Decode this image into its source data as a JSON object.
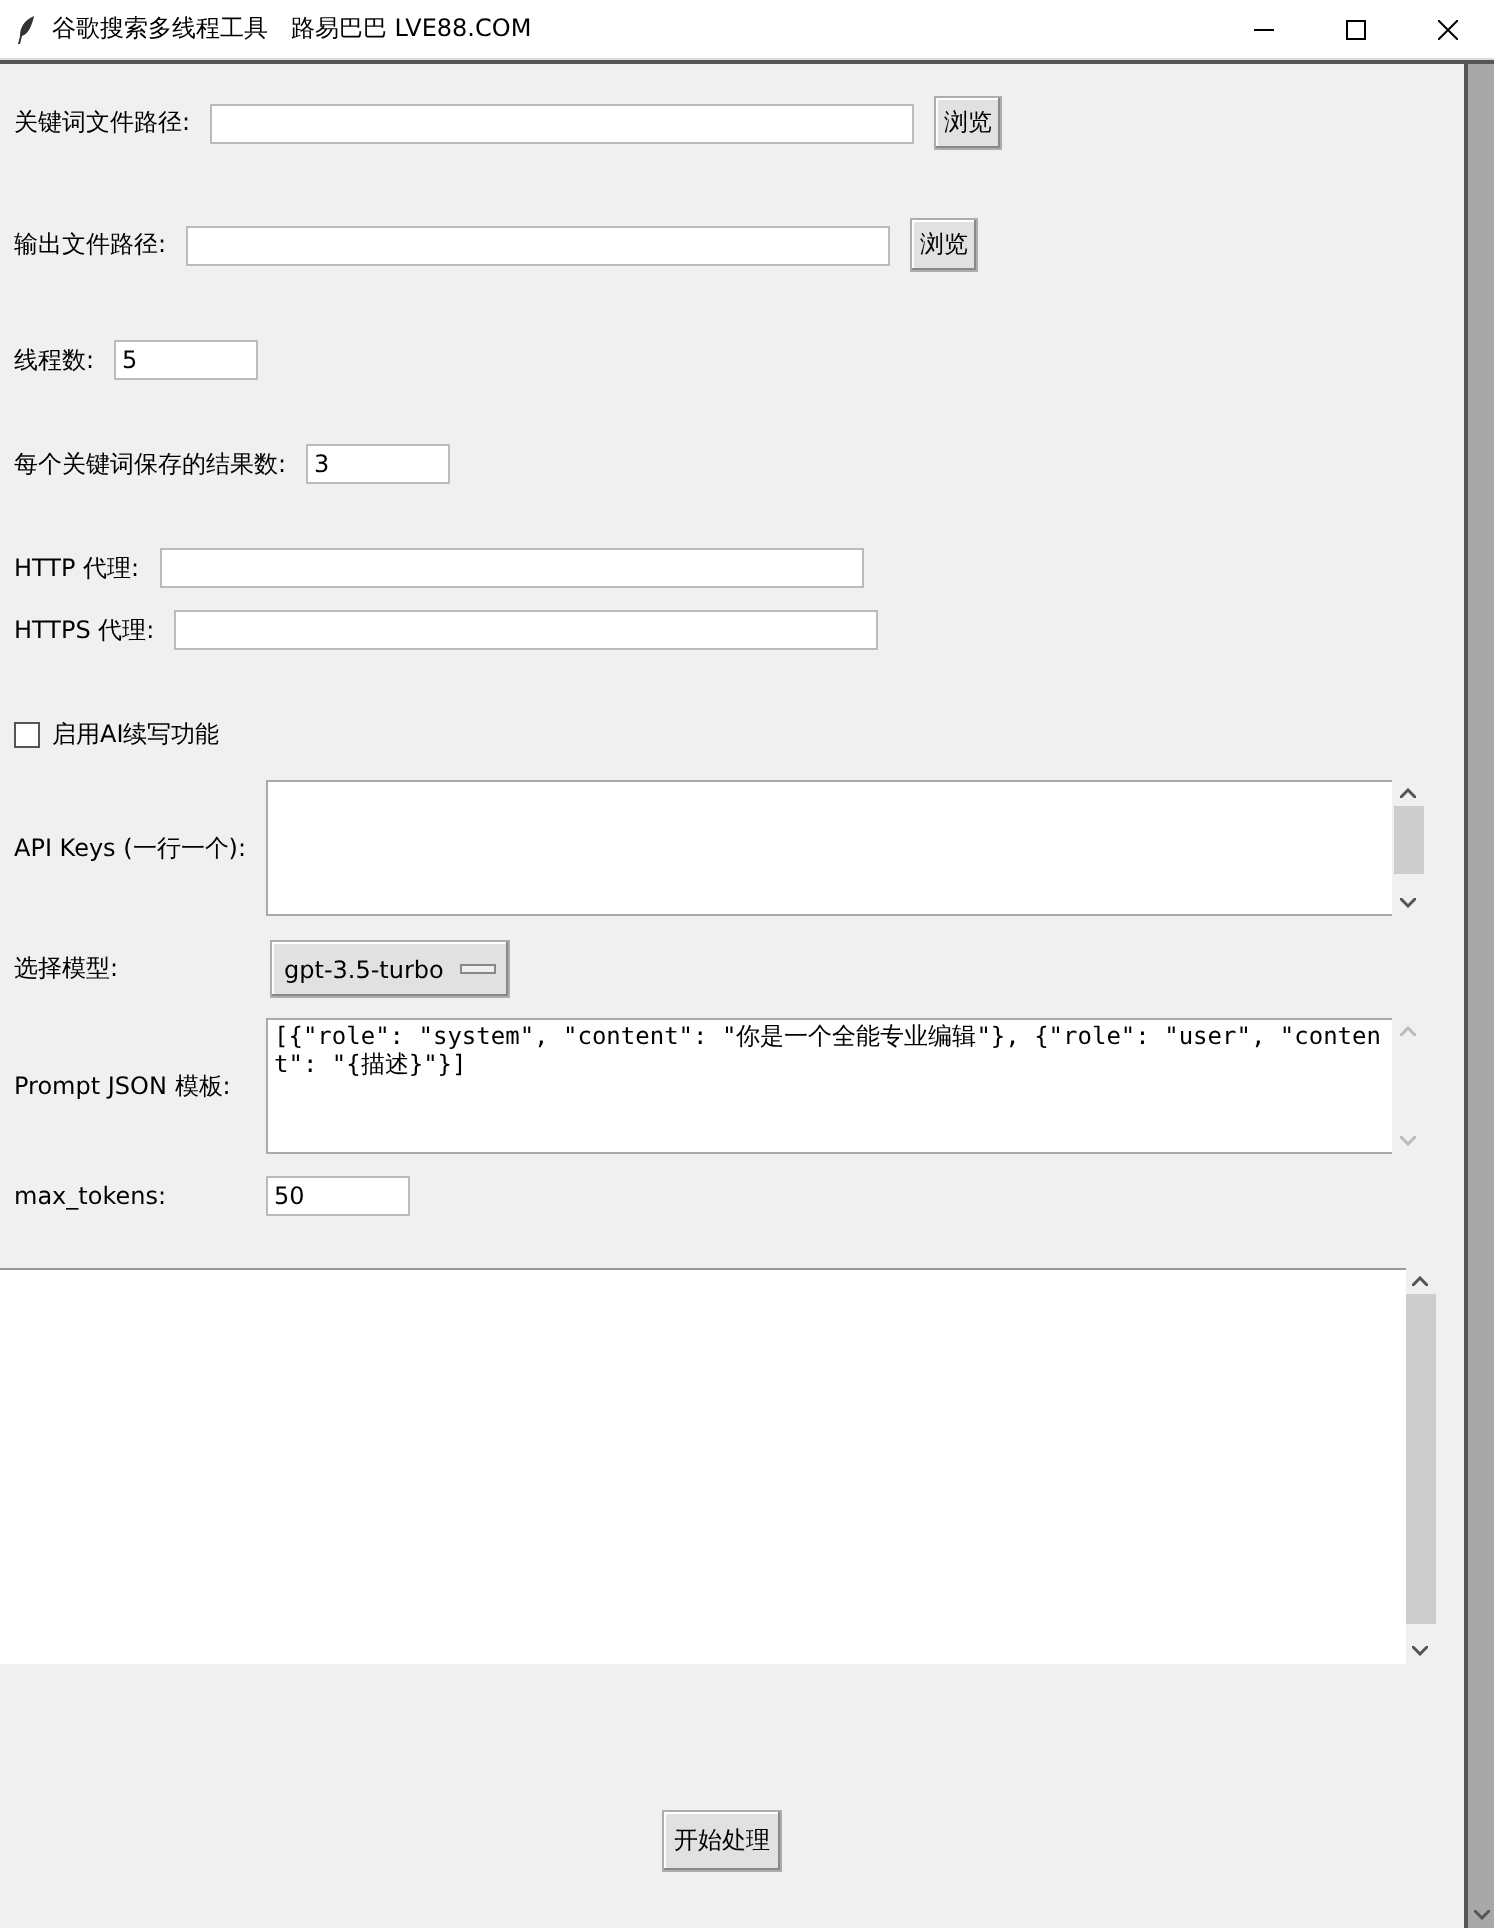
{
  "window": {
    "title": "谷歌搜索多线程工具   路易巴巴 LVE88.COM"
  },
  "keyword_file": {
    "label": "关键词文件路径:",
    "button": "浏览"
  },
  "output_file": {
    "label": "输出文件路径:",
    "button": "浏览"
  },
  "threads": {
    "label": "线程数:",
    "value": "5"
  },
  "results_per_keyword": {
    "label": "每个关键词保存的结果数:",
    "value": "3"
  },
  "http_proxy": {
    "label": "HTTP 代理:"
  },
  "https_proxy": {
    "label": "HTTPS 代理:"
  },
  "ai_option": {
    "label": "启用AI续写功能",
    "checked": false
  },
  "api_keys": {
    "label": "API Keys (一行一个):"
  },
  "model": {
    "label": "选择模型:",
    "value": "gpt-3.5-turbo"
  },
  "prompt": {
    "label": "Prompt JSON 模板:",
    "value": "[{\"role\": \"system\", \"content\": \"你是一个全能专业编辑\"}, {\"role\": \"user\", \"content\": \"{描述}\"}]"
  },
  "max_tokens": {
    "label": "max_tokens:",
    "value": "50"
  },
  "start_button": "开始处理"
}
